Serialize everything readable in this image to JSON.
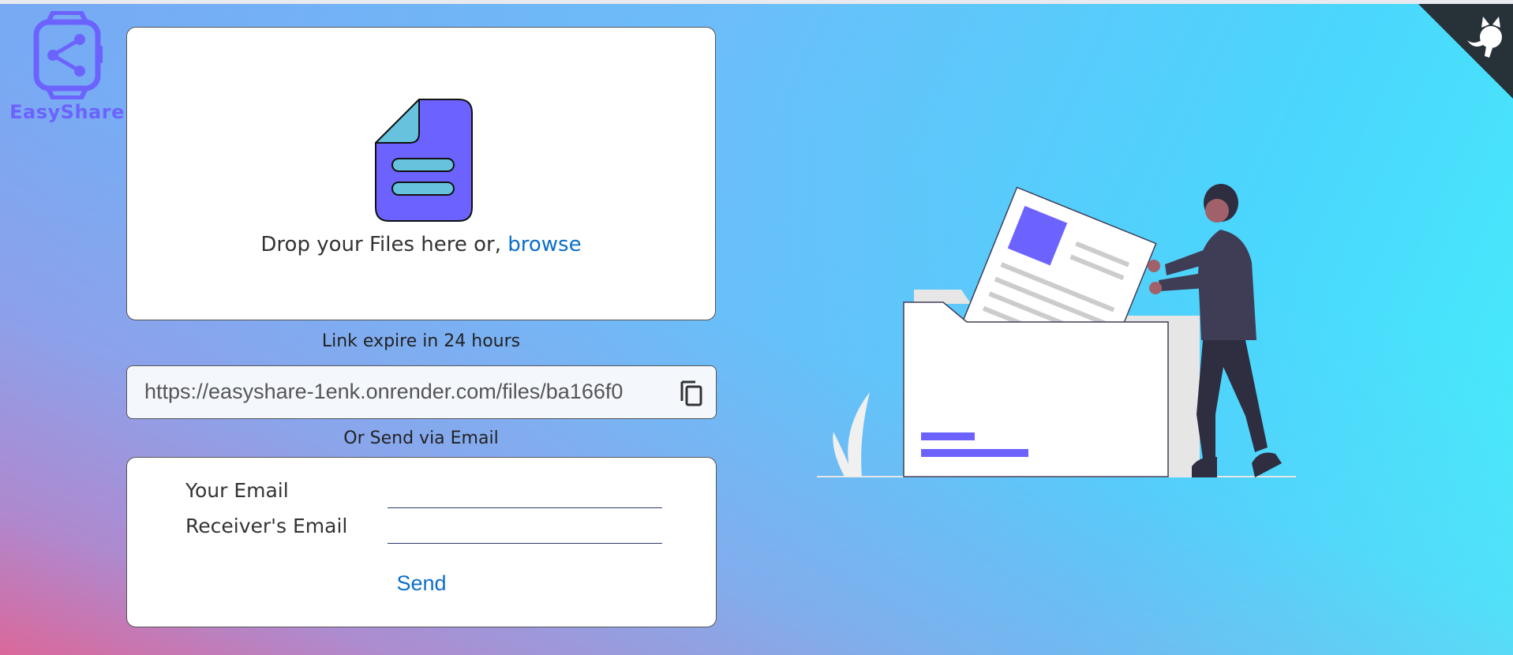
{
  "brand": {
    "name": "EasyShare"
  },
  "upload": {
    "drop_text": "Drop your Files here or, ",
    "browse_label": "browse"
  },
  "share": {
    "expiry_text": "Link expire in 24 hours",
    "link_value": "https://easyshare-1enk.onrender.com/files/ba166f0"
  },
  "email": {
    "or_text": "Or Send via Email",
    "your_email_label": "Your Email",
    "receiver_email_label": "Receiver's Email",
    "send_label": "Send"
  },
  "icons": {
    "logo": "share-watch-icon",
    "file": "file-icon",
    "copy": "copy-icon",
    "github": "github-octocat-icon"
  },
  "colors": {
    "accent": "#6c63ff",
    "link": "#0c6fc8",
    "file_fold": "#66c2dd",
    "illustration_dark": "#3f3d56"
  }
}
